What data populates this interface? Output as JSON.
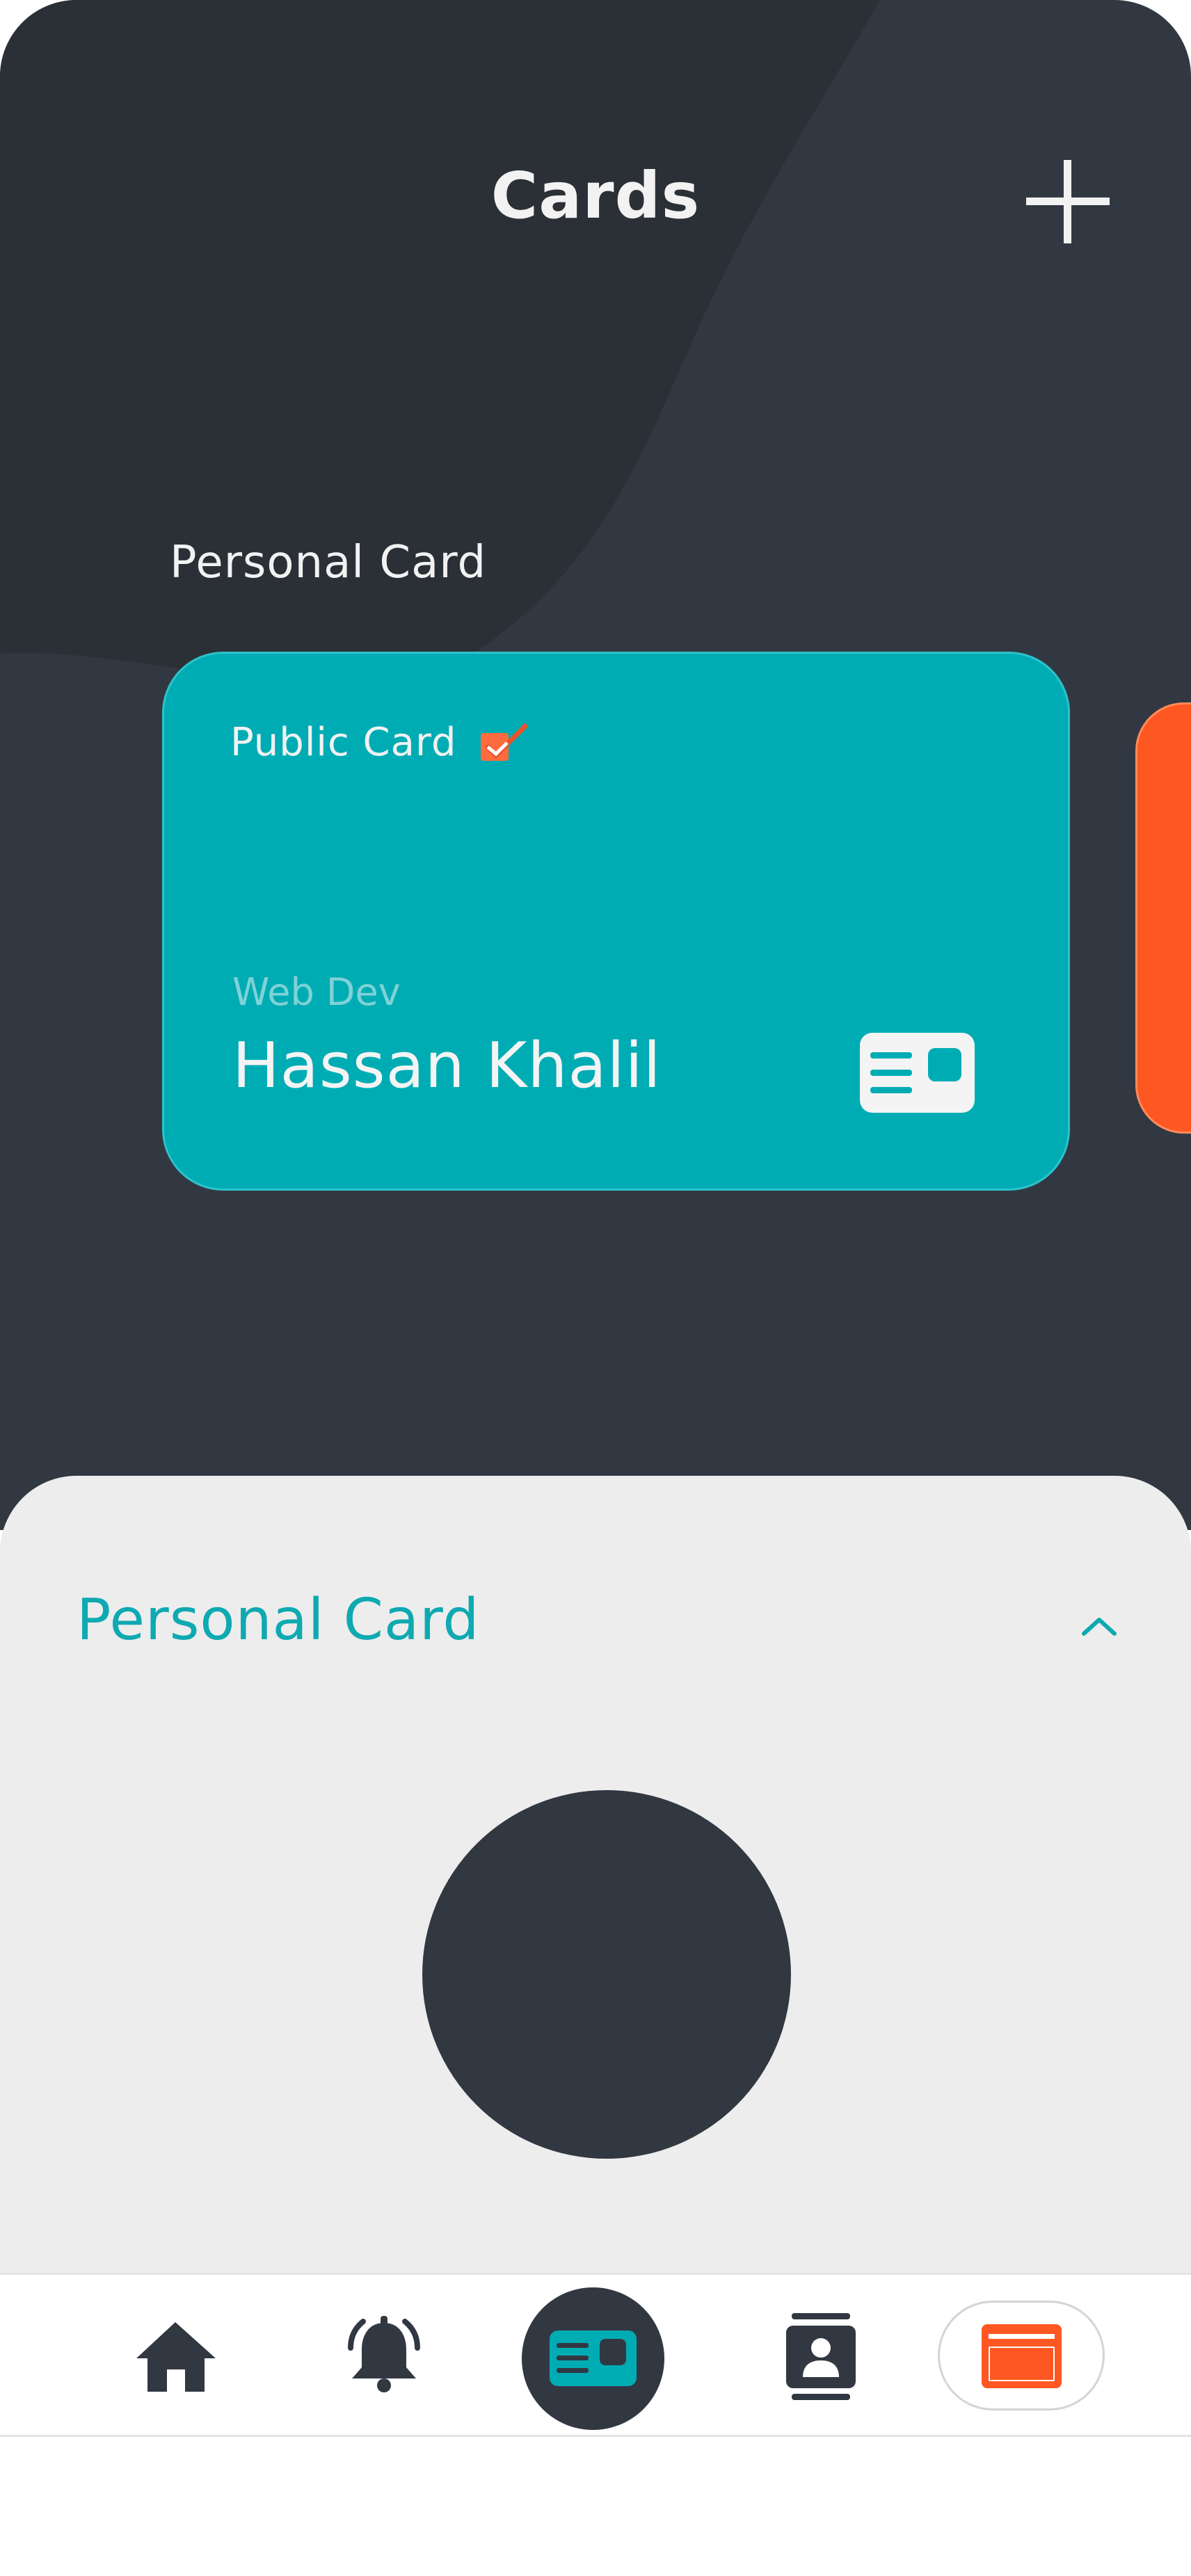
{
  "header": {
    "title": "Cards",
    "add_icon": "plus-icon"
  },
  "cards_carousel": {
    "section_label": "Personal Card",
    "active_card": {
      "public_label": "Public Card",
      "public_checked": true,
      "role": "Web Dev",
      "name": "Hassan Khalil",
      "icon": "id-card-icon",
      "color": "#00acb4"
    },
    "next_card_color": "#ff5722"
  },
  "detail_panel": {
    "title": "Personal Card",
    "collapse_icon": "chevron-up-icon",
    "avatar_color": "#323842"
  },
  "bottom_nav": {
    "items": [
      {
        "icon": "home-icon",
        "active": false
      },
      {
        "icon": "bell-icon",
        "active": false
      },
      {
        "icon": "id-card-icon",
        "active": true
      },
      {
        "icon": "contact-book-icon",
        "active": false
      },
      {
        "icon": "credit-card-icon",
        "active": false
      }
    ]
  },
  "colors": {
    "background_dark": "#323842",
    "accent_teal": "#00acb4",
    "accent_orange": "#ff5722",
    "panel_light": "#ededed"
  }
}
